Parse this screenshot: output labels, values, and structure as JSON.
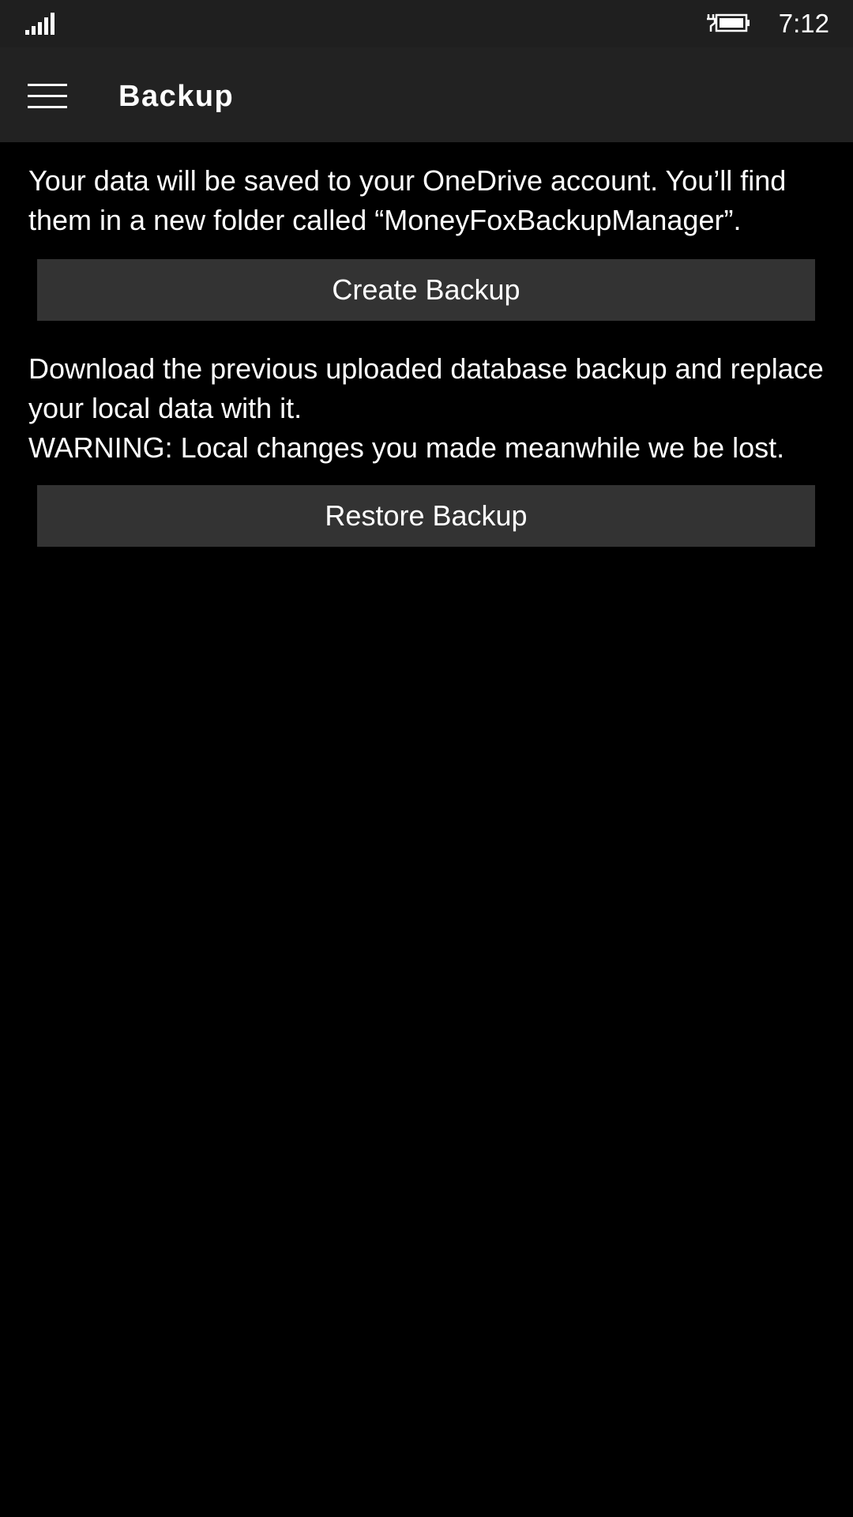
{
  "status_bar": {
    "signal_icon": "signal-strength-icon",
    "battery_icon": "battery-charging-icon",
    "time": "7:12"
  },
  "app_bar": {
    "menu_icon": "hamburger-menu-icon",
    "title": "Backup"
  },
  "backup": {
    "create_description": "Your data will be saved to your OneDrive account. You’ll find them in a new folder called “MoneyFoxBackupManager”.",
    "create_button_label": "Create Backup",
    "restore_description_line1": "Download the previous uploaded database backup and replace your local data with it.",
    "restore_description_line2": "WARNING: Local changes you made meanwhile we be lost.",
    "restore_button_label": "Restore Backup"
  },
  "colors": {
    "background": "#000000",
    "status_bar": "#1f1f1f",
    "app_bar": "#222222",
    "button": "#333333",
    "text": "#ffffff"
  }
}
